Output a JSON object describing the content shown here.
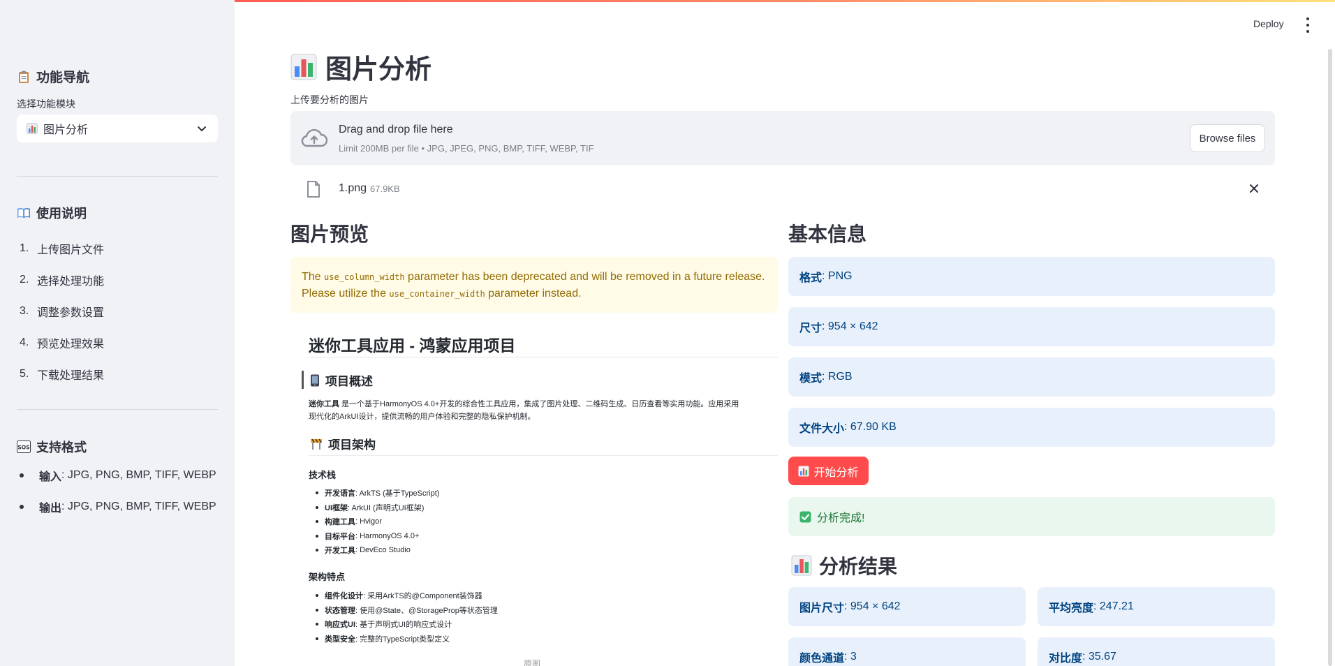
{
  "sidebar": {
    "nav_title": "功能导航",
    "select_label": "选择功能模块",
    "select_value": "图片分析",
    "guide_title": "使用说明",
    "guide_steps": [
      "上传图片文件",
      "选择处理功能",
      "调整参数设置",
      "预览处理效果",
      "下载处理结果"
    ],
    "formats_title": "支持格式",
    "formats": [
      {
        "label": "输入",
        "value": ": JPG, PNG, BMP, TIFF, WEBP"
      },
      {
        "label": "输出",
        "value": ": JPG, PNG, BMP, TIFF, WEBP"
      }
    ]
  },
  "header": {
    "deploy_label": "Deploy"
  },
  "main": {
    "title": "图片分析",
    "upload_label": "上传要分析的图片",
    "dropzone_title": "Drag and drop file here",
    "dropzone_sub": "Limit 200MB per file • JPG, JPEG, PNG, BMP, TIFF, WEBP, TIF",
    "browse_label": "Browse files",
    "file_name": "1.png",
    "file_size": "67.9KB",
    "preview_title": "图片预览",
    "warning": {
      "t1": "The ",
      "c1": "use_column_width",
      "t2": " parameter has been deprecated and will be removed in a future release.",
      "t3": "Please utilize the ",
      "c2": "use_container_width",
      "t4": " parameter instead."
    },
    "info_title": "基本信息",
    "info": [
      {
        "label": "格式",
        "value": ": PNG"
      },
      {
        "label": "尺寸",
        "value": ": 954 × 642"
      },
      {
        "label": "模式",
        "value": ": RGB"
      },
      {
        "label": "文件大小",
        "value": ": 67.90 KB"
      }
    ],
    "analyze_label": "开始分析",
    "success_text": "分析完成!",
    "results_title": "分析结果",
    "metrics": [
      {
        "label": "图片尺寸",
        "value": ": 954 × 642"
      },
      {
        "label": "平均亮度",
        "value": ": 247.21"
      },
      {
        "label": "颜色通道",
        "value": ": 3"
      },
      {
        "label": "对比度",
        "value": ": 35.67"
      }
    ]
  },
  "preview_doc": {
    "h1": "迷你工具应用 - 鸿蒙应用项目",
    "overview_title": "项目概述",
    "overview_bold": "迷你工具",
    "overview_line1": " 是一个基于HarmonyOS 4.0+开发的综合性工具应用，集成了图片处理、二维码生成、日历查看等实用功能。应用采用",
    "overview_line2": "现代化的ArkUI设计，提供流畅的用户体验和完整的隐私保护机制。",
    "arch_title": "项目架构",
    "stack_title": "技术栈",
    "stack": [
      {
        "label": "开发语言",
        "value": ": ArkTS (基于TypeScript)"
      },
      {
        "label": "UI框架",
        "value": ": ArkUI (声明式UI框架)"
      },
      {
        "label": "构建工具",
        "value": ": Hvigor"
      },
      {
        "label": "目标平台",
        "value": ": HarmonyOS 4.0+"
      },
      {
        "label": "开发工具",
        "value": ": DevEco Studio"
      }
    ],
    "features_title": "架构特点",
    "features": [
      {
        "label": "组件化设计",
        "value": ": 采用ArkTS的@Component装饰器"
      },
      {
        "label": "状态管理",
        "value": ": 使用@State、@StorageProp等状态管理"
      },
      {
        "label": "响应式UI",
        "value": ": 基于声明式UI的响应式设计"
      },
      {
        "label": "类型安全",
        "value": ": 完整的TypeScript类型定义"
      }
    ],
    "cut_text": "原图"
  },
  "colors": {
    "primary": "#ff4b4b",
    "info_bg": "#e8f1fb",
    "success_bg": "#e9f7ee",
    "warning_bg": "#fffbe6"
  }
}
